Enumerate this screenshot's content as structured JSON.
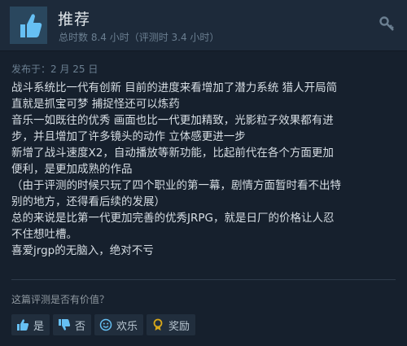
{
  "header": {
    "title": "推荐",
    "hours": "总时数 8.4 小时（评测时 3.4 小时）"
  },
  "posted": "发布于：2 月 25 日",
  "content_lines": [
    "战斗系统比一代有创新 目前的进度来看增加了潜力系统 猎人开局简",
    "直就是抓宝可梦 捕捉怪还可以炼药",
    "音乐一如既往的优秀 画面也比一代更加精致，光影粒子效果都有进",
    "步，并且增加了许多镜头的动作 立体感更进一步",
    "新增了战斗速度X2，自动播放等新功能，比起前代在各个方面更加",
    "便利，是更加成熟的作品",
    "（由于评测的时候只玩了四个职业的第一幕，剧情方面暂时看不出特",
    "别的地方，还得看后续的发展）",
    "总的来说是比第一代更加完善的优秀JRPG，就是日厂的价格让人忍",
    "不住想吐槽。",
    "喜爱jrgp的无脑入，绝对不亏"
  ],
  "helpful_question": "这篇评测是否有价值？",
  "buttons": {
    "yes": "是",
    "no": "否",
    "funny": "欢乐",
    "award": "奖励"
  },
  "icons": {
    "recommend": "thumbs-up-icon",
    "key": "key-icon",
    "yes": "thumbs-up-icon",
    "no": "thumbs-down-icon",
    "funny": "smiley-icon",
    "award": "award-icon"
  },
  "colors": {
    "accent": "#66c0f4",
    "award": "#d8a81a"
  }
}
